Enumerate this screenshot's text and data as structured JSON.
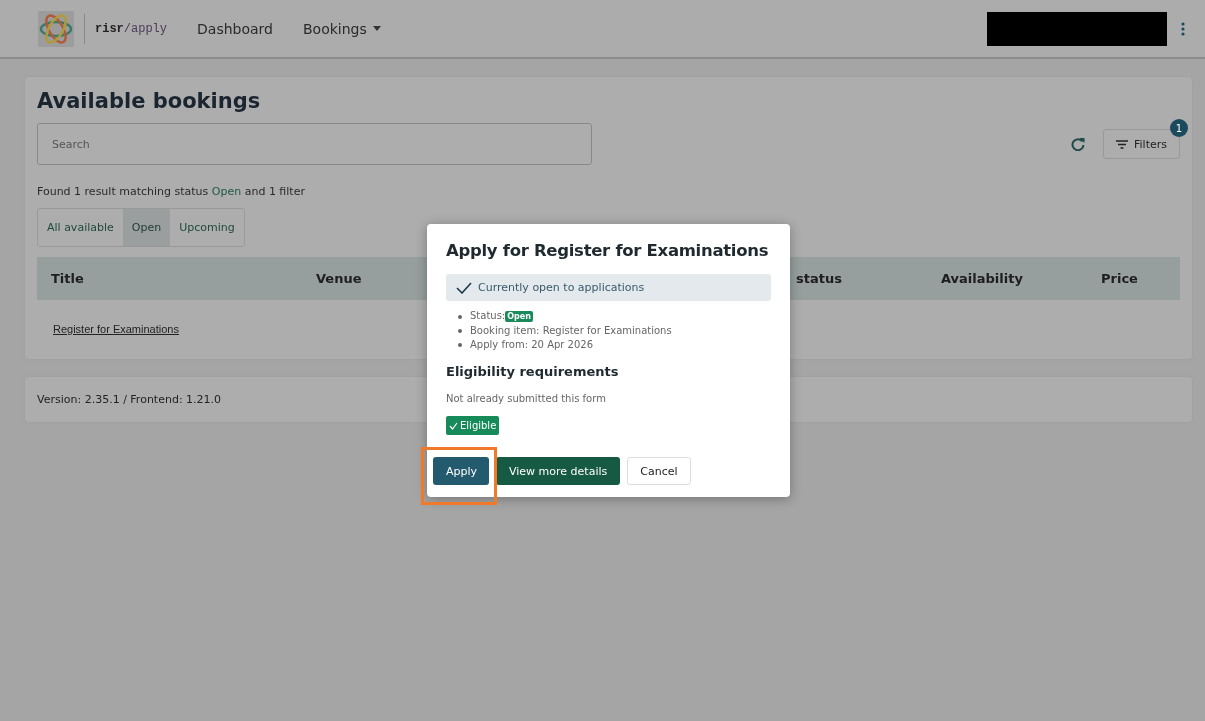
{
  "nav": {
    "brand_prefix": "risr",
    "brand_suffix": "/apply",
    "links": [
      {
        "label": "Dashboard",
        "dropdown": false
      },
      {
        "label": "Bookings",
        "dropdown": true
      }
    ],
    "user": {
      "redacted": true
    }
  },
  "page": {
    "title": "Available bookings",
    "search": {
      "placeholder": "Search"
    },
    "filters": {
      "label": "Filters",
      "count": "1"
    },
    "result_text": "Found 1 result matching status **Open** and 1 filter",
    "tabs": [
      {
        "label": "All available",
        "selected": false
      },
      {
        "label": "Open",
        "selected": true
      },
      {
        "label": "Upcoming",
        "selected": false
      }
    ],
    "table": {
      "columns": [
        "Title",
        "Venue",
        "",
        "status",
        "Availability",
        "Price"
      ],
      "rows": [
        {
          "title": "Register for Examinations"
        }
      ]
    }
  },
  "footer": {
    "version": "Version: 2.35.1 / Frontend: 1.21.0"
  },
  "modal": {
    "title": "Apply for Register for Examinations",
    "notice": "Currently open to applications",
    "details": [
      {
        "kind": "status",
        "label": "Status:",
        "badge": "Open"
      },
      {
        "kind": "text",
        "label": "Booking item: Register for Examinations"
      },
      {
        "kind": "text",
        "label": "Apply from: 20 Apr 2026"
      }
    ],
    "eligibility": {
      "heading": "Eligibility requirements",
      "requirement": "Not already submitted this form",
      "result": "Eligible",
      "eligible": true
    },
    "buttons": [
      {
        "label": "Apply",
        "kind": "primary",
        "highlighted": true
      },
      {
        "label": "View more details",
        "kind": "secondary",
        "highlighted": false
      },
      {
        "label": "Cancel",
        "kind": "plain",
        "highlighted": false
      }
    ]
  }
}
